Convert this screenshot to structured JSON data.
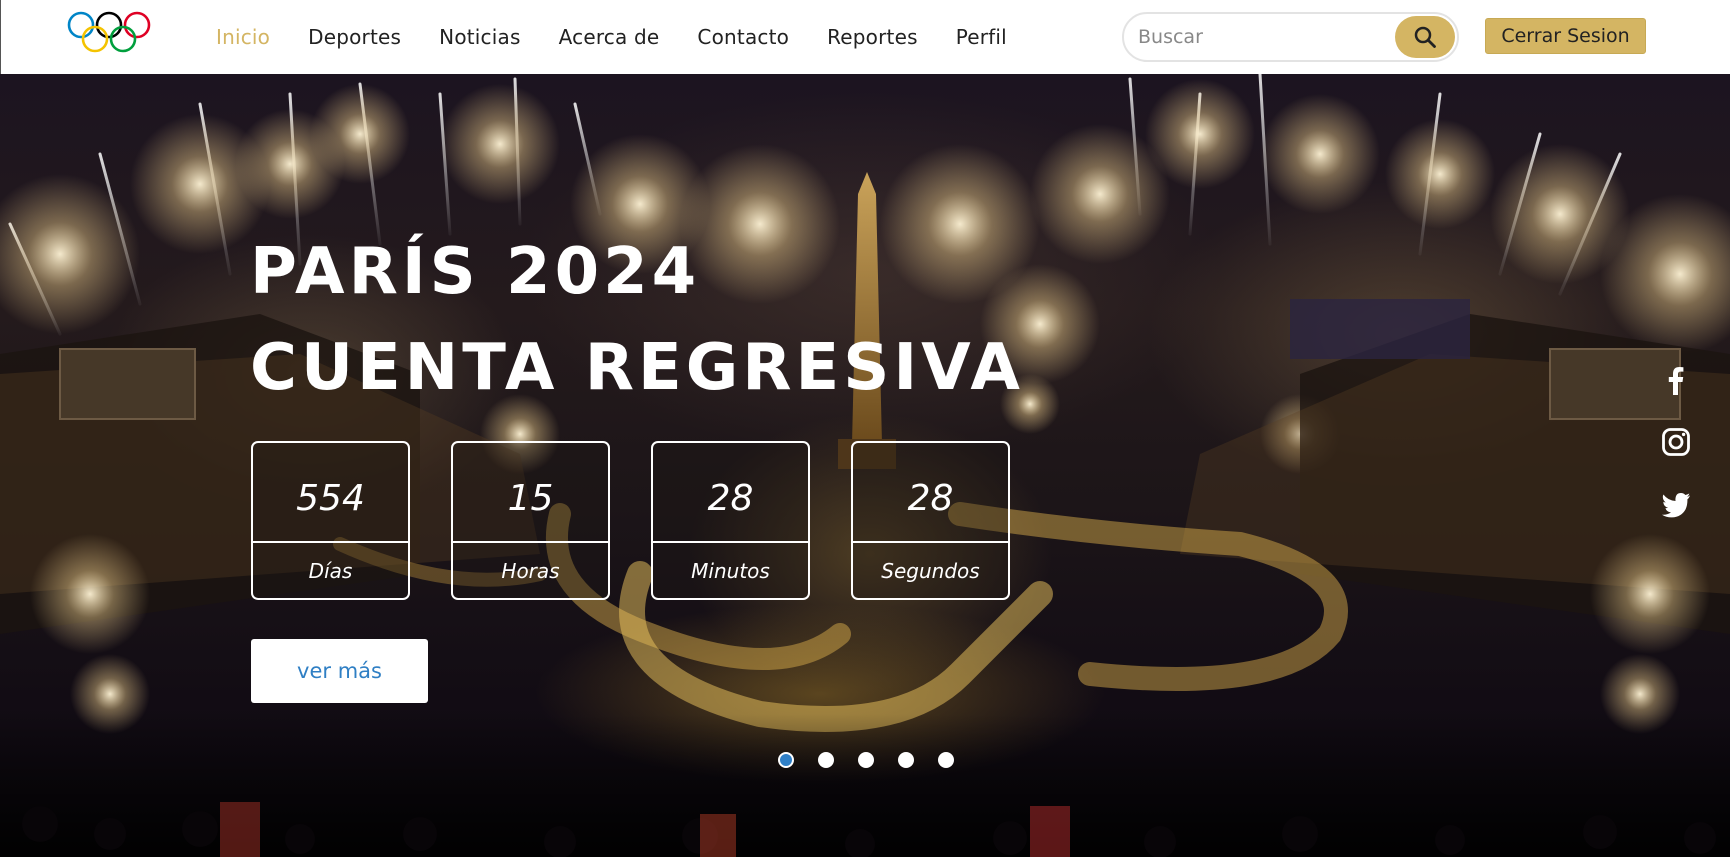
{
  "nav": {
    "items": [
      {
        "label": "Inicio",
        "active": true
      },
      {
        "label": "Deportes"
      },
      {
        "label": "Noticias"
      },
      {
        "label": "Acerca de"
      },
      {
        "label": "Contacto"
      },
      {
        "label": "Reportes"
      },
      {
        "label": "Perfil"
      }
    ],
    "search": {
      "placeholder": "Buscar",
      "icon": "search-icon"
    },
    "logout_label": "Cerrar Sesion"
  },
  "hero": {
    "title_line1": "PARÍS 2024",
    "title_line2": "CUENTA REGRESIVA",
    "countdown": [
      {
        "value": "554",
        "label": "Días"
      },
      {
        "value": "15",
        "label": "Horas"
      },
      {
        "value": "28",
        "label": "Minutos"
      },
      {
        "value": "28",
        "label": "Segundos"
      }
    ],
    "more_label": "ver más",
    "slides": {
      "count": 5,
      "active": 0
    },
    "social": [
      "facebook-icon",
      "instagram-icon",
      "twitter-icon"
    ]
  },
  "colors": {
    "accent": "#d4b563",
    "link_blue": "#2f7fc4",
    "ring_blue": "#0085c7",
    "ring_yellow": "#f4c300",
    "ring_black": "#000000",
    "ring_green": "#009f3d",
    "ring_red": "#df0024"
  }
}
